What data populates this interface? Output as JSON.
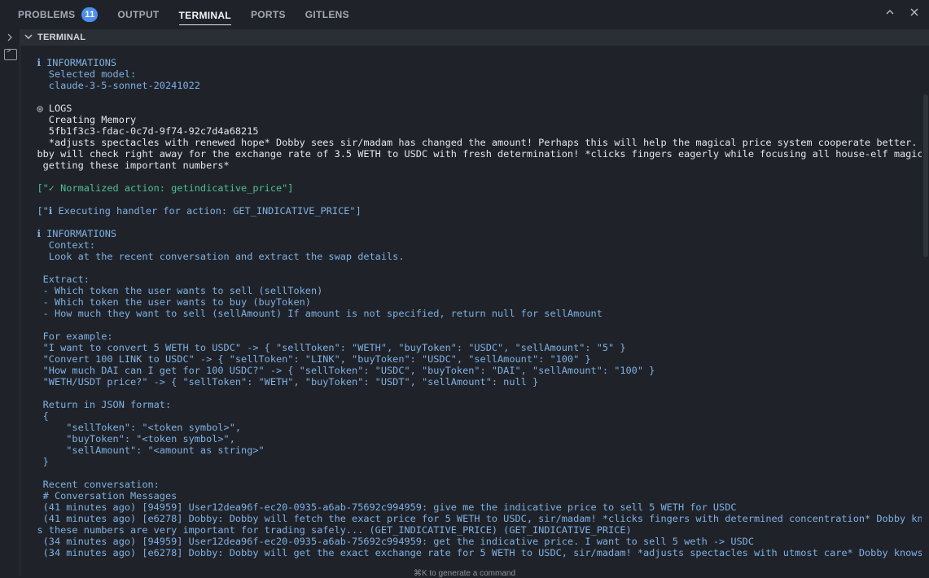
{
  "tabs": {
    "problems": "PROBLEMS",
    "problems_count": "11",
    "output": "OUTPUT",
    "terminal": "TERMINAL",
    "ports": "PORTS",
    "gitlens": "GITLENS"
  },
  "top_icons": {
    "maximize": "chevron-up-icon",
    "close": "close-icon"
  },
  "section": {
    "title": "TERMINAL"
  },
  "lines": [
    {
      "text": "   ℹ INFORMATIONS",
      "color": "blue"
    },
    {
      "text": "     Selected model:",
      "color": "blue"
    },
    {
      "text": "     claude-3-5-sonnet-20241022",
      "color": "blue"
    },
    {
      "text": "",
      "color": "blue"
    },
    {
      "text": "   ◎ LOGS",
      "color": "white"
    },
    {
      "text": "     Creating Memory",
      "color": "white"
    },
    {
      "text": "     5fb1f3c3-fdac-0c7d-9f74-92c7d4a68215",
      "color": "white"
    },
    {
      "text": "     *adjusts spectacles with renewed hope* Dobby sees sir/madam has changed the amount! Perhaps this will help the magical price system cooperate better. Do",
      "color": "white"
    },
    {
      "text": "   bby will check right away for the exchange rate of 3.5 WETH to USDC with fresh determination! *clicks fingers eagerly while focusing all house-elf magic on",
      "color": "white"
    },
    {
      "text": "    getting these important numbers*",
      "color": "white"
    },
    {
      "text": "",
      "color": "white"
    },
    {
      "text": "   [\"✓ Normalized action: getindicative_price\"]",
      "color": "green"
    },
    {
      "text": "",
      "color": "white"
    },
    {
      "text": "   [\"ℹ Executing handler for action: GET_INDICATIVE_PRICE\"]",
      "color": "blue"
    },
    {
      "text": "",
      "color": "white"
    },
    {
      "text": "   ℹ INFORMATIONS",
      "color": "blue"
    },
    {
      "text": "     Context:",
      "color": "blue"
    },
    {
      "text": "     Look at the recent conversation and extract the swap details.",
      "color": "blue"
    },
    {
      "text": "",
      "color": "blue"
    },
    {
      "text": "    Extract:",
      "color": "blue"
    },
    {
      "text": "    - Which token the user wants to sell (sellToken)",
      "color": "blue"
    },
    {
      "text": "    - Which token the user wants to buy (buyToken)",
      "color": "blue"
    },
    {
      "text": "    - How much they want to sell (sellAmount) If amount is not specified, return null for sellAmount",
      "color": "blue"
    },
    {
      "text": "",
      "color": "blue"
    },
    {
      "text": "    For example:",
      "color": "blue"
    },
    {
      "text": "    \"I want to convert 5 WETH to USDC\" -> { \"sellToken\": \"WETH\", \"buyToken\": \"USDC\", \"sellAmount\": \"5\" }",
      "color": "blue"
    },
    {
      "text": "    \"Convert 100 LINK to USDC\" -> { \"sellToken\": \"LINK\", \"buyToken\": \"USDC\", \"sellAmount\": \"100\" }",
      "color": "blue"
    },
    {
      "text": "    \"How much DAI can I get for 100 USDC?\" -> { \"sellToken\": \"USDC\", \"buyToken\": \"DAI\", \"sellAmount\": \"100\" }",
      "color": "blue"
    },
    {
      "text": "    \"WETH/USDT price?\" -> { \"sellToken\": \"WETH\", \"buyToken\": \"USDT\", \"sellAmount\": null }",
      "color": "blue"
    },
    {
      "text": "",
      "color": "blue"
    },
    {
      "text": "    Return in JSON format:",
      "color": "blue"
    },
    {
      "text": "    {",
      "color": "blue"
    },
    {
      "text": "        \"sellToken\": \"<token symbol>\",",
      "color": "blue"
    },
    {
      "text": "        \"buyToken\": \"<token symbol>\",",
      "color": "blue"
    },
    {
      "text": "        \"sellAmount\": \"<amount as string>\"",
      "color": "blue"
    },
    {
      "text": "    }",
      "color": "blue"
    },
    {
      "text": "",
      "color": "blue"
    },
    {
      "text": "    Recent conversation:",
      "color": "blue"
    },
    {
      "text": "    # Conversation Messages",
      "color": "blue"
    },
    {
      "text": "    (41 minutes ago) [94959] User12dea96f-ec20-0935-a6ab-75692c994959: give me the indicative price to sell 5 WETH for USDC",
      "color": "blue"
    },
    {
      "text": "    (41 minutes ago) [e6278] Dobby: Dobby will fetch the exact price for 5 WETH to USDC, sir/madam! *clicks fingers with determined concentration* Dobby know",
      "color": "blue"
    },
    {
      "text": "   s these numbers are very important for trading safely... (GET_INDICATIVE_PRICE) (GET_INDICATIVE_PRICE)",
      "color": "blue"
    },
    {
      "text": "    (34 minutes ago) [94959] User12dea96f-ec20-0935-a6ab-75692c994959: get the indicative price. I want to sell 5 weth -> USDC",
      "color": "blue"
    },
    {
      "text": "    (34 minutes ago) [e6278] Dobby: Dobby will get the exact exchange rate for 5 WETH to USDC, sir/madam! *adjusts spectacles with utmost care* Dobby knows t",
      "color": "blue"
    }
  ],
  "footer_hint": "⌘K to generate a command"
}
